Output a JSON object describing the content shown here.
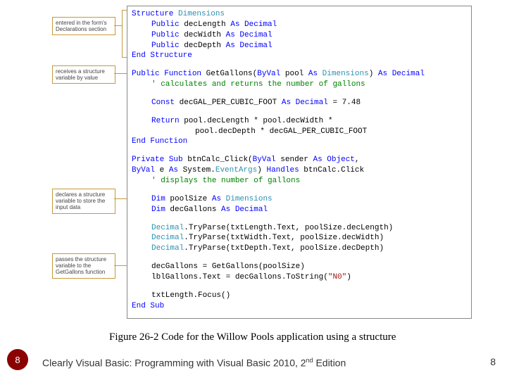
{
  "annotations": {
    "ann1": "entered in the form's Declarations section",
    "ann2": "receives a structure variable by value",
    "ann3": "declares a structure variable to store the input data",
    "ann4": "passes the structure variable to the GetGallons function"
  },
  "code": {
    "l1_a": "Structure",
    "l1_b": " Dimensions",
    "l2_a": "Public",
    "l2_b": " decLength ",
    "l2_c": "As Decimal",
    "l3_a": "Public",
    "l3_b": " decWidth ",
    "l3_c": "As Decimal",
    "l4_a": "Public",
    "l4_b": " decDepth ",
    "l4_c": "As Decimal",
    "l5_a": "End Structure",
    "l6_a": "Public Function",
    "l6_b": " GetGallons(",
    "l6_c": "ByVal",
    "l6_d": " pool ",
    "l6_e": "As",
    "l6_f": " Dimensions",
    "l6_g": ") ",
    "l6_h": "As Decimal",
    "l7": "' calculates and returns the number of gallons",
    "l8_a": "Const",
    "l8_b": " decGAL_PER_CUBIC_FOOT ",
    "l8_c": "As Decimal",
    "l8_d": " = 7.48",
    "l9_a": "Return",
    "l9_b": " pool.decLength * pool.decWidth *",
    "l10": "pool.decDepth * decGAL_PER_CUBIC_FOOT",
    "l11_a": "End Function",
    "l12_a": "Private Sub",
    "l12_b": " btnCalc_Click(",
    "l12_c": "ByVal",
    "l12_d": " sender ",
    "l12_e": "As Object",
    "l12_f": ",",
    "l13_a": "ByVal",
    "l13_b": " e ",
    "l13_c": "As",
    "l13_d": " System.",
    "l13_e": "EventArgs",
    "l13_f": ") ",
    "l13_g": "Handles",
    "l13_h": " btnCalc.Click",
    "l14": "' displays the number of gallons",
    "l15_a": "Dim",
    "l15_b": " poolSize ",
    "l15_c": "As",
    "l15_d": " Dimensions",
    "l16_a": "Dim",
    "l16_b": " decGallons ",
    "l16_c": "As Decimal",
    "l17_a": "Decimal",
    "l17_b": ".TryParse(txtLength.Text, poolSize.decLength)",
    "l18_a": "Decimal",
    "l18_b": ".TryParse(txtWidth.Text, poolSize.decWidth)",
    "l19_a": "Decimal",
    "l19_b": ".TryParse(txtDepth.Text, poolSize.decDepth)",
    "l20": "decGallons = GetGallons(poolSize)",
    "l21_a": "lblGallons.Text = decGallons.ToString(",
    "l21_b": "\"N0\"",
    "l21_c": ")",
    "l22": "txtLength.Focus()",
    "l23_a": "End Sub"
  },
  "caption": "Figure 26-2 Code for the Willow Pools application using a structure",
  "footer_prefix": "Clearly Visual Basic: Programming with Visual Basic 2010, 2",
  "footer_suffix": " Edition",
  "footer_sup": "nd",
  "page_left": "8",
  "page_right": "8"
}
